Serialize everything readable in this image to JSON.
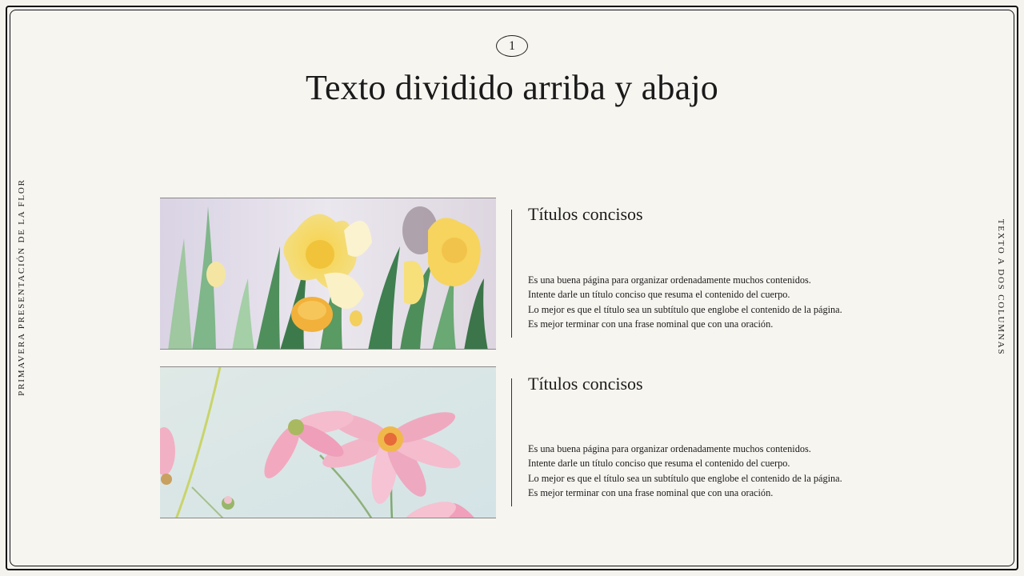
{
  "slide": {
    "page_number": "1",
    "title": "Texto dividido arriba y abajo",
    "side_left_label": "PRIMAVERA PRESENTACIÓN DE LA FLOR",
    "side_right_label": "TEXTO A DOS COLUMNAS"
  },
  "sections": [
    {
      "heading": "Títulos concisos",
      "image_icon": "daffodil-photo",
      "lines": [
        "Es una buena página para organizar ordenadamente muchos contenidos.",
        "Intente darle un título conciso que resuma el contenido del cuerpo.",
        "Lo mejor es que el título sea un subtítulo que englobe el contenido de la página.",
        "Es mejor terminar con una frase nominal que con una oración."
      ]
    },
    {
      "heading": "Títulos concisos",
      "image_icon": "cosmos-flower-photo",
      "lines": [
        "Es una buena página para organizar ordenadamente muchos contenidos.",
        "Intente darle un título conciso que resuma el contenido del cuerpo.",
        "Lo mejor es que el título sea un subtítulo que englobe el contenido de la página.",
        "Es mejor terminar con una frase nominal que con una oración."
      ]
    }
  ],
  "colors": {
    "background": "#f7f5f0",
    "frame": "#111111",
    "text": "#1a1a1a"
  }
}
